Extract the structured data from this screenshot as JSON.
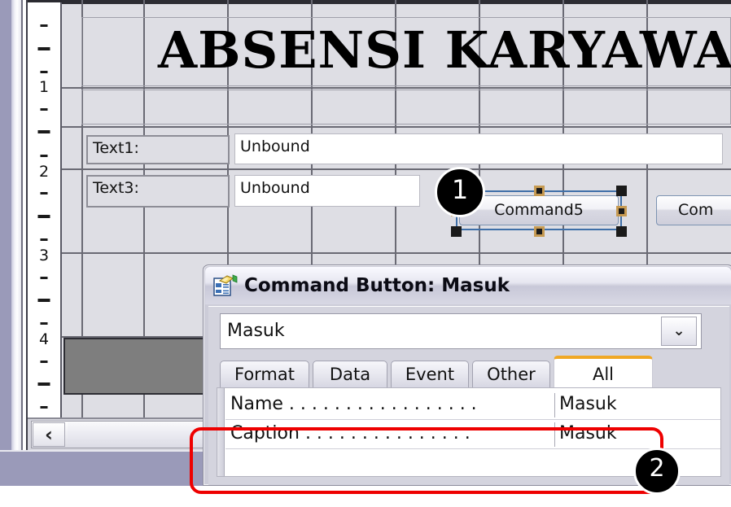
{
  "ruler": {
    "name": "vertical-ruler",
    "numbers": [
      "1",
      "2",
      "3",
      "4"
    ]
  },
  "form": {
    "title": "ABSENSI KARYAWAN",
    "labels": [
      {
        "text": "Text1:"
      },
      {
        "text": "Text3:"
      }
    ],
    "textboxes": [
      {
        "value": "Unbound"
      },
      {
        "value": "Unbound"
      }
    ],
    "buttons": [
      {
        "caption": "Command5",
        "selected": true
      },
      {
        "caption": "Com",
        "selected": false
      }
    ]
  },
  "scrollbar": {
    "left_arrow": "‹"
  },
  "dialog": {
    "icon": "property-sheet-icon",
    "title": "Command Button: Masuk",
    "combo": {
      "value": "Masuk",
      "arrow": "⌄"
    },
    "tabs": [
      {
        "label": "Format",
        "active": false
      },
      {
        "label": "Data",
        "active": false
      },
      {
        "label": "Event",
        "active": false
      },
      {
        "label": "Other",
        "active": false
      },
      {
        "label": "All",
        "active": true
      }
    ],
    "properties": [
      {
        "name": "Name . . . . . . . . . . . . . . . . .",
        "value": "Masuk"
      },
      {
        "name": "Caption . . . . . . . . . . . . . . .",
        "value": "Masuk"
      }
    ]
  },
  "annotations": {
    "badge1": "1",
    "badge2": "2",
    "highlight_color": "#ee0000",
    "badge_color": "#000000"
  }
}
